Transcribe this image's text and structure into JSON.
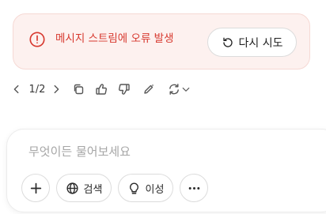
{
  "error": {
    "message": "메시지 스트림에 오류 발생",
    "retry_label": "다시 시도",
    "color": "#d7382e",
    "background": "#fdf1ef"
  },
  "toolbar": {
    "page_indicator": "1/2",
    "icons": [
      "chevron-left-icon",
      "chevron-right-icon",
      "copy-icon",
      "thumbs-up-icon",
      "thumbs-down-icon",
      "edit-icon",
      "regenerate-icon",
      "chevron-down-icon"
    ]
  },
  "composer": {
    "placeholder": "무엇이든 물어보세요",
    "search_label": "검색",
    "reason_label": "이성"
  }
}
